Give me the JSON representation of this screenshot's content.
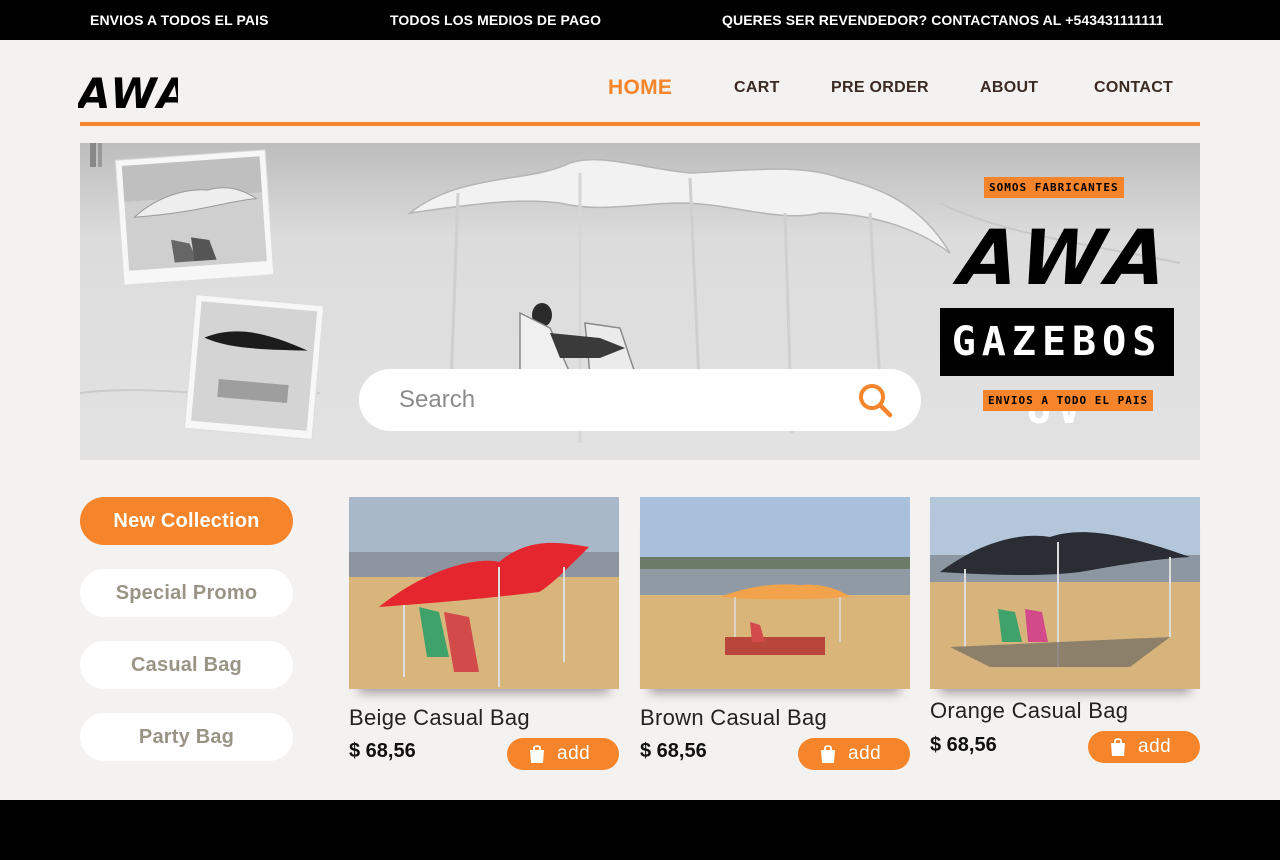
{
  "topbar": {
    "msg1": "ENVIOS A TODOS EL PAIS",
    "msg2": "TODOS LOS MEDIOS DE PAGO",
    "msg3": "QUERES SER REVENDEDOR? CONTACTANOS AL +543431111111"
  },
  "header": {
    "logo": "AWA",
    "nav": {
      "home": "HOME",
      "cart": "CART",
      "preorder": "PRE ORDER",
      "about": "ABOUT",
      "contact": "CONTACT"
    }
  },
  "hero": {
    "search_placeholder": "Search",
    "tag_top": "SOMOS FABRICANTES",
    "brand": "AWA",
    "product_line": "GAZEBOS UV",
    "tag_bottom": "ENVIOS A TODO EL PAIS"
  },
  "sidebar": {
    "items": [
      {
        "label": "New Collection"
      },
      {
        "label": "Special Promo"
      },
      {
        "label": "Casual Bag"
      },
      {
        "label": "Party Bag"
      }
    ]
  },
  "products": [
    {
      "title": "Beige Casual Bag",
      "price": "$ 68,56",
      "add_label": "add",
      "tent_color": "#e5262f"
    },
    {
      "title": "Brown Casual Bag",
      "price": "$ 68,56",
      "add_label": "add",
      "tent_color": "#f2a24a"
    },
    {
      "title": "Orange Casual Bag",
      "price": "$ 68,56",
      "add_label": "add",
      "tent_color": "#2a2d33"
    }
  ],
  "colors": {
    "accent": "#f5842a",
    "topbar_bg": "#000000",
    "page_bg": "#f4f2f0"
  }
}
